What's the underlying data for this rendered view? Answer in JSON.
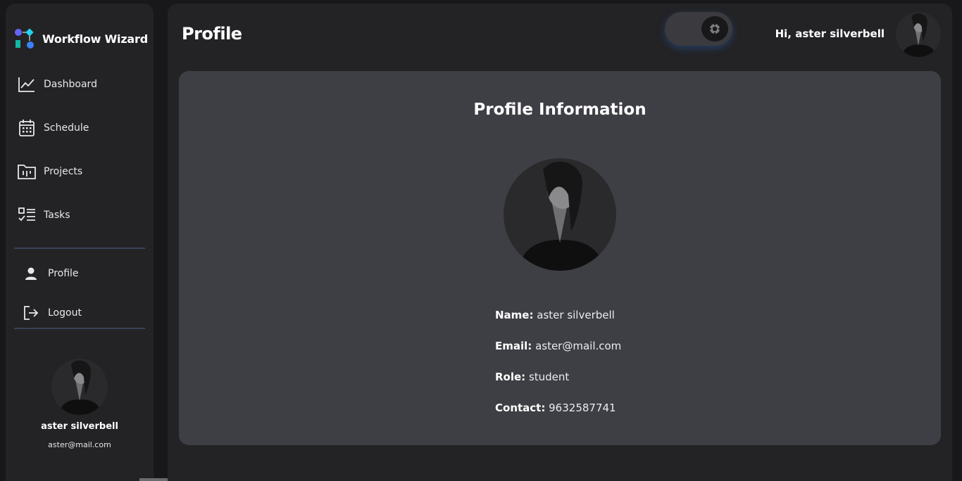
{
  "app": {
    "name": "Workflow Wizard"
  },
  "sidebar": {
    "items": [
      {
        "label": "Dashboard",
        "icon": "chart-line-icon"
      },
      {
        "label": "Schedule",
        "icon": "calendar-icon"
      },
      {
        "label": "Projects",
        "icon": "folder-kanban-icon"
      },
      {
        "label": "Tasks",
        "icon": "checklist-icon"
      }
    ],
    "account_items": [
      {
        "label": "Profile",
        "icon": "user-icon"
      },
      {
        "label": "Logout",
        "icon": "logout-icon"
      }
    ],
    "user": {
      "name": "aster silverbell",
      "email": "aster@mail.com"
    }
  },
  "header": {
    "title": "Profile",
    "greeting": "Hi, aster silverbell",
    "theme_toggle_icon": "gear-icon"
  },
  "profile_card": {
    "title": "Profile Information",
    "fields": [
      {
        "key": "Name:",
        "value": "aster silverbell"
      },
      {
        "key": "Email:",
        "value": "aster@mail.com"
      },
      {
        "key": "Role:",
        "value": "student"
      },
      {
        "key": "Contact:",
        "value": "9632587741"
      }
    ]
  },
  "colors": {
    "background": "#18181b",
    "panel": "#232326",
    "card": "#3e3f45",
    "divider": "#3a4356",
    "brand_blue": "#3b82f6",
    "brand_teal": "#14b8a6"
  }
}
